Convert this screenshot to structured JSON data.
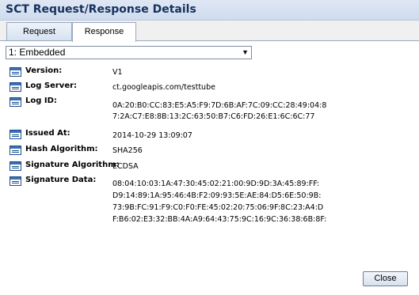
{
  "window": {
    "title": "SCT Request/Response Details"
  },
  "tabs": [
    {
      "label": "Request"
    },
    {
      "label": "Response"
    }
  ],
  "select": {
    "value": "1: Embedded"
  },
  "fields": [
    {
      "label": "Version:",
      "value": "V1"
    },
    {
      "label": "Log Server:",
      "value": "ct.googleapis.com/testtube"
    },
    {
      "label": "Log ID:",
      "lines": [
        "0A:20:B0:CC:83:E5:A5:F9:7D:6B:AF:7C:09:CC:28:49:04:8",
        "7:2A:C7:E8:8B:13:2C:63:50:B7:C6:FD:26:E1:6C:6C:77"
      ]
    },
    {
      "label": "Issued At:",
      "value": "2014-10-29 13:09:07"
    },
    {
      "label": "Hash Algorithm:",
      "value": "SHA256"
    },
    {
      "label": "Signature Algorithm:",
      "value": "ECDSA"
    },
    {
      "label": "Signature Data:",
      "lines": [
        "08:04:10:03:1A:47:30:45:02:21:00:9D:9D:3A:45:89:FF:",
        "D9:14:89:1A:95:46:4B:F2:09:93:5E:AE:84:D5:6E:50:9B:",
        "73:9B:FC:91:F9:C0:F0:FE:45:02:20:75:06:9F:8C:23:A4:D",
        "F:B6:02:E3:32:BB:4A:A9:64:43:75:9C:16:9C:36:38:6B:8F:"
      ]
    }
  ],
  "buttons": {
    "close": "Close"
  }
}
